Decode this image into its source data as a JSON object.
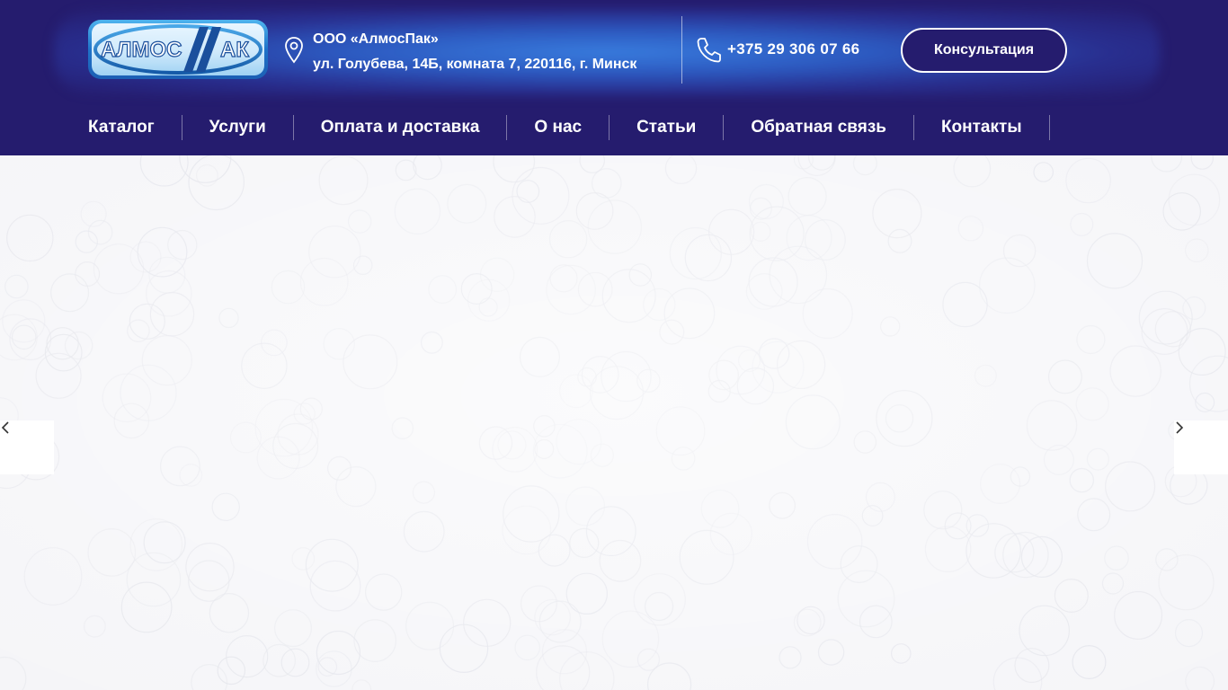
{
  "logo": {
    "text_left": "АЛМОС",
    "text_right": "АК",
    "icon": "almospak-logo"
  },
  "contact": {
    "company": "ООО «АлмосПак»",
    "address": "ул. Голубева, 14Б, комната 7, 220116, г. Минск",
    "phone": "+375 29 306 07 66",
    "pin_icon": "map-pin-icon",
    "phone_icon": "phone-icon"
  },
  "header": {
    "consult_label": "Консультация"
  },
  "nav": {
    "items": [
      {
        "label": "Каталог"
      },
      {
        "label": "Услуги"
      },
      {
        "label": "Оплата и доставка"
      },
      {
        "label": "О нас"
      },
      {
        "label": "Статьи"
      },
      {
        "label": "Обратная связь"
      },
      {
        "label": "Контакты"
      }
    ]
  },
  "slider": {
    "prev_icon": "chevron-left-icon",
    "next_icon": "chevron-right-icon"
  },
  "colors": {
    "header_bg": "#251c6e",
    "accent_glow": "#3a82e4",
    "hero_bg": "#f5f5f8",
    "logo_blue": "#1f73c9"
  }
}
